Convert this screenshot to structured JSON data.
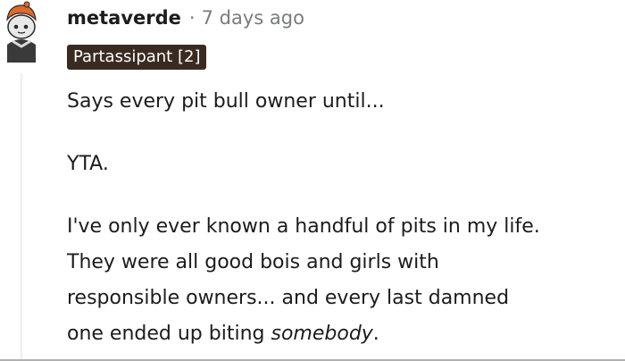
{
  "comment": {
    "username": "metaverde",
    "separator": "·",
    "timestamp": "7 days ago",
    "flair": "Partassipant [2]",
    "paragraphs": {
      "p1": "Says every pit bull owner until...",
      "p2": "YTA.",
      "p3": {
        "line1": "I've only ever known a handful of pits in my life.",
        "line2": "They were all good bois and girls with",
        "line3": "responsible owners... and every last damned",
        "line4_prefix": "one ended up biting ",
        "line4_emphasis": "somebody",
        "line4_suffix": "."
      }
    }
  },
  "colors": {
    "flair_bg": "#3a2b22",
    "meta_gray": "#787c7e",
    "text": "#1c1c1c",
    "thread_line": "#edeff1"
  },
  "icons": {
    "avatar": "snoo-avatar-icon"
  }
}
